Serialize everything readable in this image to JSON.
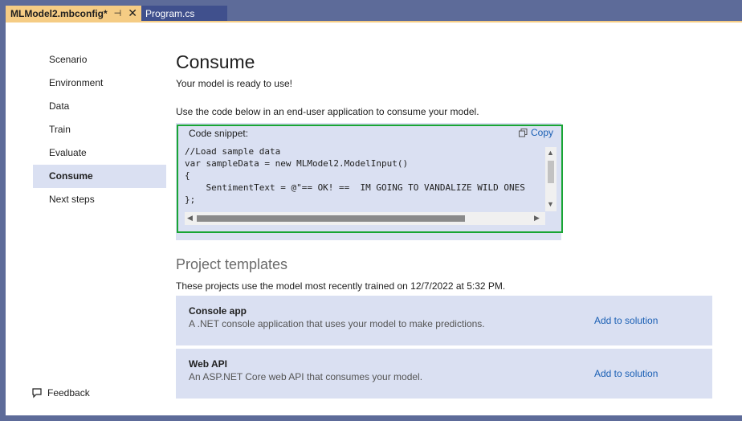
{
  "tabs": {
    "active": {
      "title": "MLModel2.mbconfig*",
      "pin_glyph": "⊣",
      "close_glyph": "✕"
    },
    "inactive": {
      "title": "Program.cs"
    }
  },
  "sidebar": {
    "items": [
      {
        "label": "Scenario"
      },
      {
        "label": "Environment"
      },
      {
        "label": "Data"
      },
      {
        "label": "Train"
      },
      {
        "label": "Evaluate"
      },
      {
        "label": "Consume"
      },
      {
        "label": "Next steps"
      }
    ],
    "active_index": 5,
    "feedback_label": "Feedback"
  },
  "main": {
    "title": "Consume",
    "subtitle": "Your model is ready to use!",
    "instruction": "Use the code below in an end-user application to consume your model.",
    "snippet": {
      "label": "Code snippet:",
      "copy_label": "Copy",
      "lines": [
        "//Load sample data",
        "var sampleData = new MLModel2.ModelInput()",
        "{",
        "    SentimentText = @\"== OK! ==  IM GOING TO VANDALIZE WILD ONES",
        "};"
      ]
    },
    "templates": {
      "title": "Project templates",
      "description": "These projects use the model most recently trained on 12/7/2022 at 5:32 PM.",
      "items": [
        {
          "name": "Console app",
          "description": "A .NET console application that uses your model to make predictions.",
          "action_label": "Add to solution"
        },
        {
          "name": "Web API",
          "description": "An ASP.NET Core web API that consumes your model.",
          "action_label": "Add to solution"
        }
      ]
    }
  },
  "colors": {
    "frame": "#5d6b99",
    "active_tab": "#f5cc84",
    "selection": "#dae0f2",
    "snippet_border": "#18a534",
    "link": "#1a5fb4"
  }
}
